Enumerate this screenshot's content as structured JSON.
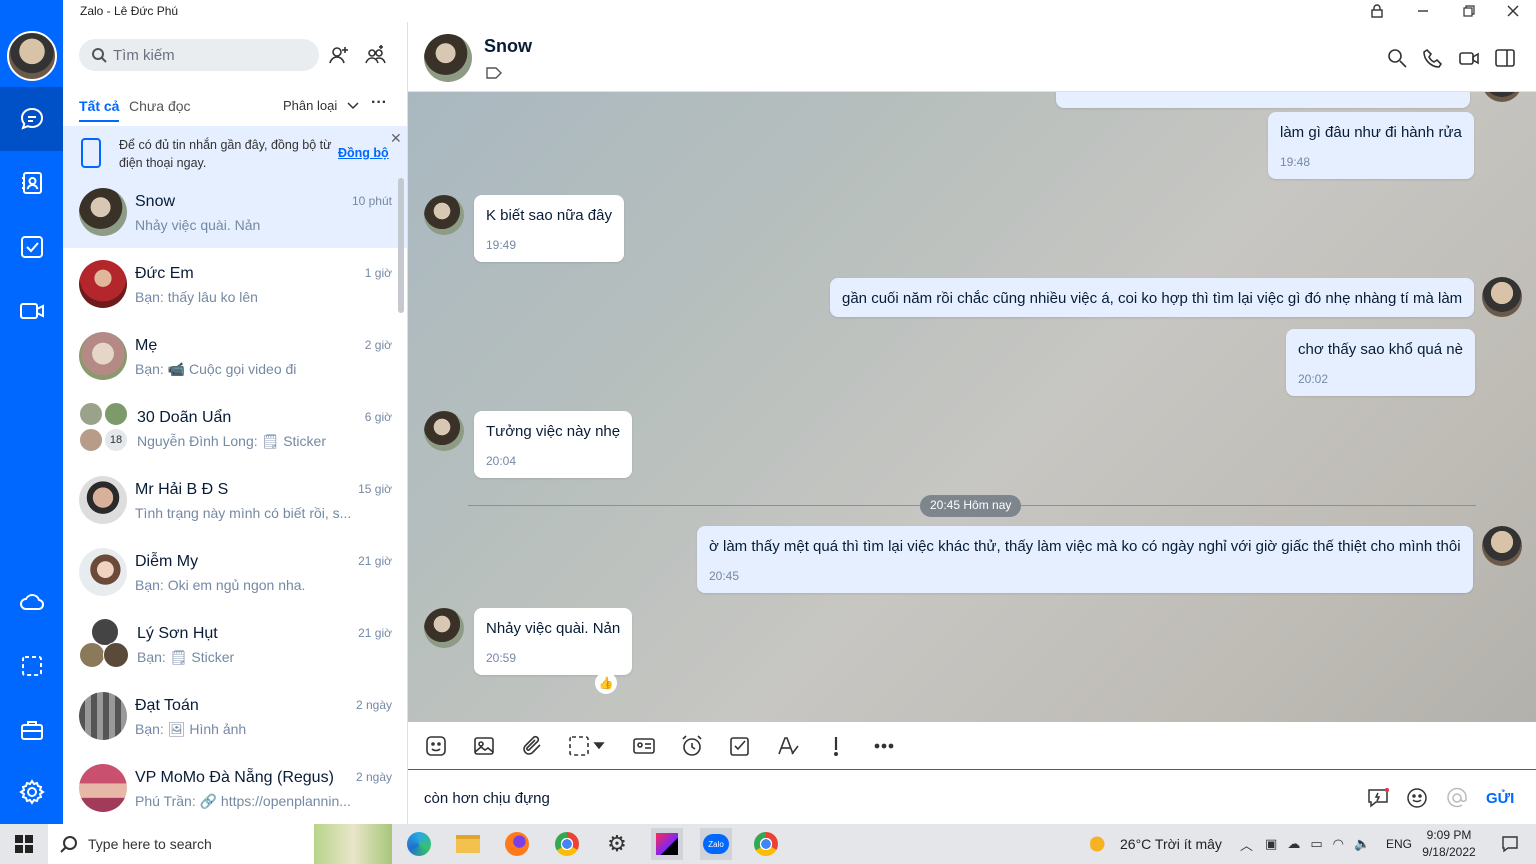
{
  "window": {
    "title": "Zalo - Lê Đức Phú"
  },
  "sidebar": {
    "search_placeholder": "Tìm kiếm",
    "tabs": {
      "all": "Tất cả",
      "unread": "Chưa đọc",
      "classify": "Phân loại"
    },
    "sync_banner": {
      "text": "Để có đủ tin nhắn gần đây, đồng bộ từ điện thoại ngay.",
      "link": "Đồng bộ"
    },
    "conversations": [
      {
        "name": "Snow",
        "preview": "Nhảy việc quài. Nản",
        "time": "10 phút"
      },
      {
        "name": "Đức Em",
        "preview": "Bạn: thấy lâu ko lên",
        "time": "1 giờ"
      },
      {
        "name": "Mẹ",
        "preview": "Bạn: 📹 Cuộc gọi video đi",
        "time": "2 giờ"
      },
      {
        "name": "30 Doãn Uẩn",
        "preview": "Nguyễn Đình Long: 🗒 Sticker",
        "time": "6 giờ",
        "badge": "18"
      },
      {
        "name": "Mr Hải B Đ S",
        "preview": "Tình trạng này mình có biết rồi, s...",
        "time": "15 giờ"
      },
      {
        "name": "Diễm My",
        "preview": "Bạn: Oki em ngủ ngon nha.",
        "time": "21 giờ"
      },
      {
        "name": "Lý Sơn Hụt",
        "preview": "Bạn: 🗒 Sticker",
        "time": "21 giờ"
      },
      {
        "name": "Đạt Toán",
        "preview": "Bạn: 🖼 Hình ảnh",
        "time": "2 ngày"
      },
      {
        "name": "VP MoMo Đà Nẵng (Regus)",
        "preview": "Phú Trần: 🔗 https://openplannin...",
        "time": "2 ngày"
      }
    ]
  },
  "chat": {
    "contact": "Snow",
    "messages": [
      {
        "text": "làm gì đâu như đi hành rửa",
        "time": "19:48"
      },
      {
        "text": "K biết sao nữa đây",
        "time": "19:49"
      },
      {
        "text": "gần cuối năm rồi chắc cũng nhiều việc á, coi ko hợp thì tìm lại việc gì đó nhẹ nhàng tí mà làm"
      },
      {
        "text": "chơ thấy sao khổ quá nè",
        "time": "20:02"
      },
      {
        "text": "Tưởng việc này nhẹ",
        "time": "20:04"
      },
      {
        "text": "ờ làm thấy mệt quá thì tìm lại việc khác thử, thấy làm việc mà ko có ngày nghỉ với giờ giấc thế thiệt cho mình thôi",
        "time": "20:45"
      },
      {
        "text": "Nhảy việc quài. Nản",
        "time": "20:59"
      }
    ],
    "divider": "20:45 Hôm nay",
    "input_value": "còn hơn chịu đựng",
    "send_label": "GỬI"
  },
  "taskbar": {
    "search_placeholder": "Type here to search",
    "weather": "26°C  Trời ít mây",
    "lang": "ENG",
    "time": "9:09 PM",
    "date": "9/18/2022"
  },
  "colors": {
    "brand": "#0068ff",
    "my_bubble": "#e5efff"
  }
}
